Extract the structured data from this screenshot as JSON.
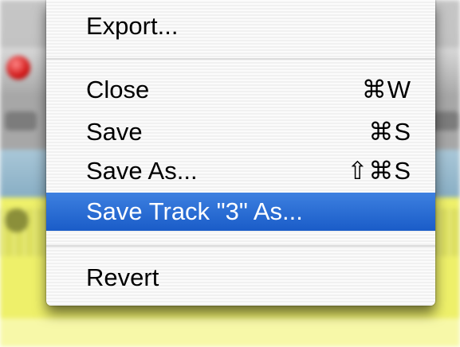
{
  "menu": {
    "items": [
      {
        "label": "Export...",
        "shortcut": ""
      },
      {
        "label": "Close",
        "shortcut": "⌘W"
      },
      {
        "label": "Save",
        "shortcut": "⌘S"
      },
      {
        "label": "Save As...",
        "shortcut": "⇧⌘S"
      },
      {
        "label": "Save Track \"3\" As...",
        "shortcut": ""
      },
      {
        "label": "Revert",
        "shortcut": ""
      }
    ],
    "selected_index": 4
  },
  "colors": {
    "selection": "#2a6ad6",
    "track": "#eef06a"
  }
}
